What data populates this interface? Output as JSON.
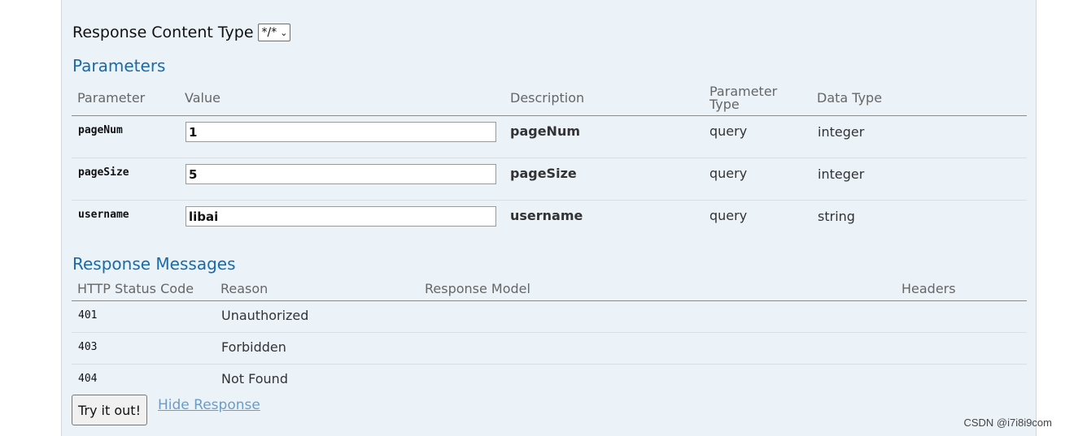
{
  "content_type": {
    "label": "Response Content Type",
    "selected": "*/*"
  },
  "parameters": {
    "title": "Parameters",
    "headers": {
      "parameter": "Parameter",
      "value": "Value",
      "description": "Description",
      "param_type_line1": "Parameter",
      "param_type_line2": "Type",
      "data_type": "Data Type"
    },
    "rows": [
      {
        "name": "pageNum",
        "value": "1",
        "description": "pageNum",
        "type": "query",
        "data_type": "integer"
      },
      {
        "name": "pageSize",
        "value": "5",
        "description": "pageSize",
        "type": "query",
        "data_type": "integer"
      },
      {
        "name": "username",
        "value": "libai",
        "description": "username",
        "type": "query",
        "data_type": "string"
      }
    ]
  },
  "responses": {
    "title": "Response Messages",
    "headers": {
      "code": "HTTP Status Code",
      "reason": "Reason",
      "model": "Response Model",
      "headers": "Headers"
    },
    "rows": [
      {
        "code": "401",
        "reason": "Unauthorized"
      },
      {
        "code": "403",
        "reason": "Forbidden"
      },
      {
        "code": "404",
        "reason": "Not Found"
      }
    ]
  },
  "actions": {
    "try_label": "Try it out!",
    "hide_label": "Hide Response"
  },
  "watermark": "CSDN @i7i8i9com",
  "icons": {
    "select_chevron": "chevron-down-icon"
  },
  "colors": {
    "panel_bg": "#ebf3f9",
    "section_title": "#1a6aa8",
    "link": "#6a9cc8"
  }
}
